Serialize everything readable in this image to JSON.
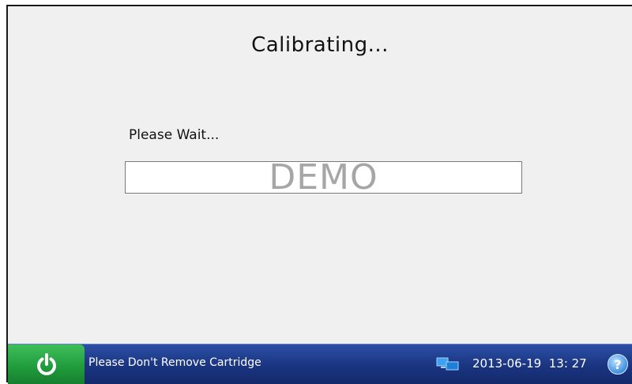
{
  "screen": {
    "title": "Calibrating...",
    "wait_message": "Please Wait...",
    "progress_percent": 0,
    "watermark": "DEMO"
  },
  "statusbar": {
    "message": "Please Don't Remove Cartridge",
    "date": "2013-06-19",
    "time": "13: 27",
    "help_symbol": "?",
    "icons": {
      "power": "power-icon",
      "network": "network-icon",
      "help": "help-icon"
    }
  },
  "colors": {
    "background": "#f0f0f0",
    "statusbar": "#1a3480",
    "power_button": "#1f9a3a",
    "help_button": "#3e8ee0"
  }
}
